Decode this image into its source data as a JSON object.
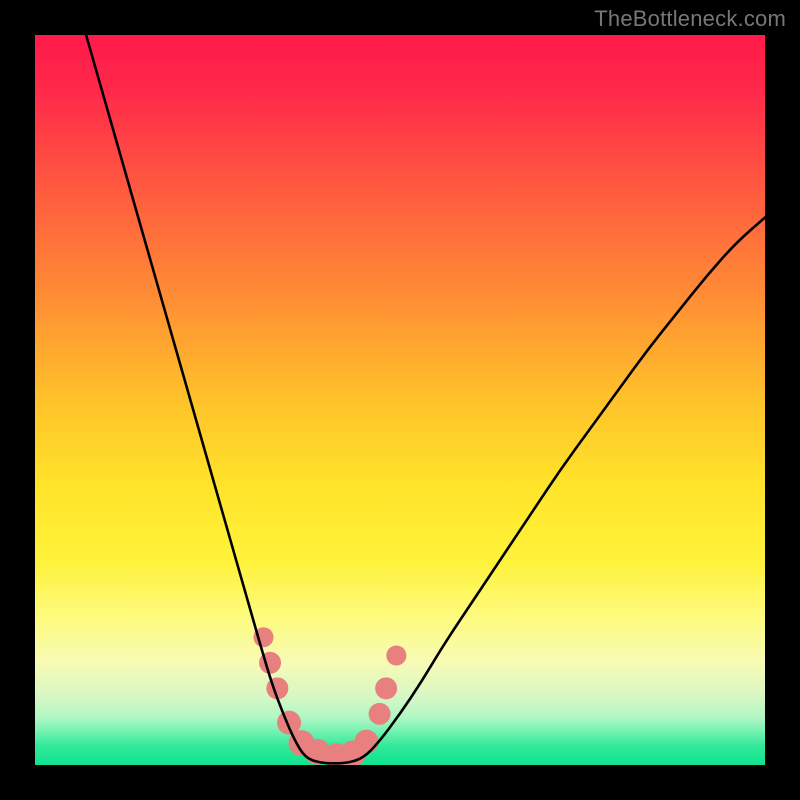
{
  "watermark": "TheBottleneck.com",
  "chart_data": {
    "type": "line",
    "title": "",
    "xlabel": "",
    "ylabel": "",
    "xlim": [
      0,
      100
    ],
    "ylim": [
      0,
      100
    ],
    "grid": false,
    "legend": false,
    "gradient_stops": [
      {
        "offset": 0,
        "color": "#ff1a4a"
      },
      {
        "offset": 0.08,
        "color": "#ff2a4a"
      },
      {
        "offset": 0.2,
        "color": "#ff5640"
      },
      {
        "offset": 0.35,
        "color": "#ff8a35"
      },
      {
        "offset": 0.5,
        "color": "#ffc22a"
      },
      {
        "offset": 0.62,
        "color": "#ffe42a"
      },
      {
        "offset": 0.72,
        "color": "#fff23a"
      },
      {
        "offset": 0.8,
        "color": "#fdfb80"
      },
      {
        "offset": 0.86,
        "color": "#f7fbb5"
      },
      {
        "offset": 0.905,
        "color": "#d8f7c4"
      },
      {
        "offset": 0.935,
        "color": "#b0f7c4"
      },
      {
        "offset": 0.955,
        "color": "#70f2b0"
      },
      {
        "offset": 0.975,
        "color": "#30e89a"
      },
      {
        "offset": 1.0,
        "color": "#10e48f"
      }
    ],
    "series": [
      {
        "name": "left-curve",
        "x": [
          7,
          9,
          11,
          13,
          15,
          17,
          19,
          21,
          23,
          25,
          27,
          29,
          31,
          32.5,
          34,
          35.5,
          37
        ],
        "y": [
          100,
          93,
          86,
          79,
          72,
          65,
          58,
          51,
          44,
          37,
          30,
          23,
          16,
          11,
          7,
          3.5,
          1
        ]
      },
      {
        "name": "right-curve",
        "x": [
          45,
          47,
          50,
          53,
          56,
          60,
          64,
          68,
          72,
          76,
          80,
          84,
          88,
          92,
          96,
          100
        ],
        "y": [
          1,
          3,
          7,
          11.5,
          16.5,
          22.5,
          28.5,
          34.5,
          40.5,
          46,
          51.5,
          57,
          62,
          67,
          71.5,
          75
        ]
      },
      {
        "name": "floor",
        "x": [
          37,
          39,
          41,
          43,
          45
        ],
        "y": [
          1,
          0.3,
          0.2,
          0.3,
          1
        ]
      }
    ],
    "markers": [
      {
        "x": 31.3,
        "y": 17.5,
        "r": 10
      },
      {
        "x": 32.2,
        "y": 14.0,
        "r": 11
      },
      {
        "x": 33.2,
        "y": 10.5,
        "r": 11
      },
      {
        "x": 34.8,
        "y": 5.8,
        "r": 12
      },
      {
        "x": 36.5,
        "y": 3.0,
        "r": 13
      },
      {
        "x": 38.7,
        "y": 1.8,
        "r": 13
      },
      {
        "x": 41.3,
        "y": 1.2,
        "r": 13
      },
      {
        "x": 43.6,
        "y": 1.6,
        "r": 13
      },
      {
        "x": 45.4,
        "y": 3.2,
        "r": 12
      },
      {
        "x": 47.2,
        "y": 7.0,
        "r": 11
      },
      {
        "x": 48.1,
        "y": 10.5,
        "r": 11
      },
      {
        "x": 49.5,
        "y": 15.0,
        "r": 10
      }
    ],
    "marker_color": "#e98080",
    "curve_color": "#000000",
    "curve_width": 2.6
  }
}
